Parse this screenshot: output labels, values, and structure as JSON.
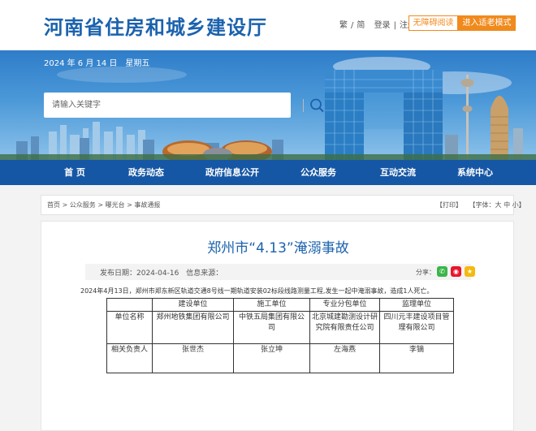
{
  "header": {
    "site_title": "河南省住房和城乡建设厅",
    "lang_trad": "繁",
    "lang_sep": "/",
    "lang_simp": "简",
    "login": "登录",
    "bar": "|",
    "register": "注册",
    "barrier_free": "无障碍阅读",
    "elder_mode": "进入适老模式"
  },
  "banner": {
    "date": "2024 年 6 月 14 日　星期五",
    "search_placeholder": "请输入关键字"
  },
  "nav": [
    {
      "label": "首 页"
    },
    {
      "label": "政务动态"
    },
    {
      "label": "政府信息公开"
    },
    {
      "label": "公众服务"
    },
    {
      "label": "互动交流"
    },
    {
      "label": "系统中心"
    }
  ],
  "breadcrumb": {
    "home": "首页",
    "sep": ">",
    "service": "公众服务",
    "exposure": "曝光台",
    "notice": "事故通报",
    "print": "【打印】",
    "font_label": "【字体：",
    "font_large": "大",
    "font_mid": "中",
    "font_small": "小",
    "font_close": "】"
  },
  "article": {
    "title": "郑州市“4.13”淹溺事故",
    "publish": "发布日期：2024-04-16　信息来源：",
    "share_label": "分享：",
    "paragraph": "2024年4月13日，郑州市郑东新区轨道交通8号线一期轨道安装02标段线路测量工程,发生一起中淹溺事故，造成1人死亡。",
    "table": {
      "headers": [
        "",
        "建设单位",
        "施工单位",
        "专业分包单位",
        "监理单位"
      ],
      "rows": [
        [
          "单位名称",
          "郑州地铁集团有限公司",
          "中铁五局集团有限公司",
          "北京城建勘测设计研究院有限责任公司",
          "四川元丰建设项目管理有限公司"
        ],
        [
          "相关负责人",
          "张世杰",
          "张立坤",
          "左海燕",
          "李镝"
        ]
      ]
    }
  },
  "colors": {
    "brand_blue": "#1b62ad",
    "nav_blue": "#1657a5",
    "accent_orange": "#f08a1c",
    "wechat_green": "#3bb54a",
    "weibo_red": "#e6162d",
    "qzone_yellow": "#f5b90f"
  },
  "icons": [
    "search-icon",
    "wechat-icon",
    "weibo-icon",
    "qzone-icon"
  ]
}
